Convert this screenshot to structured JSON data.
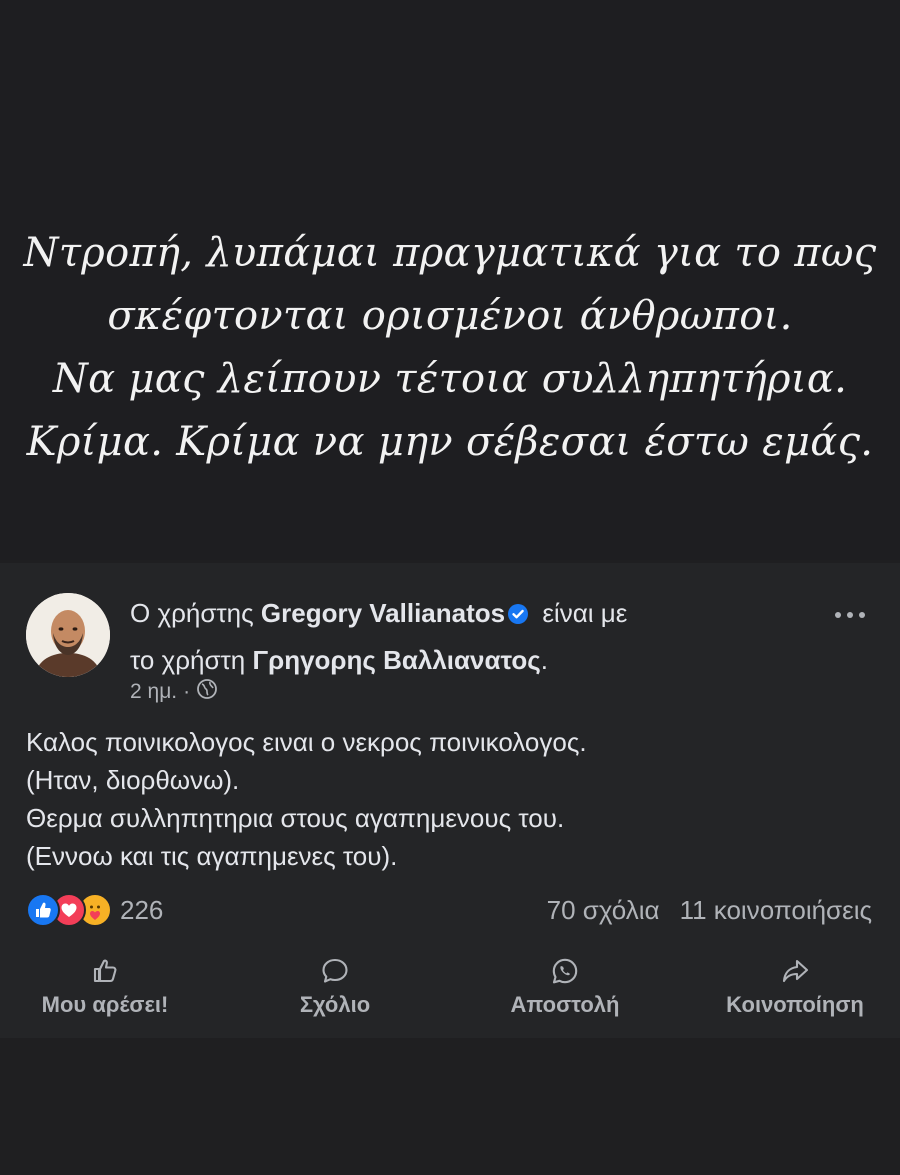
{
  "quote": {
    "lines": [
      "Ντροπή, λυπάμαι πραγματικά για το πως",
      "σκέφτονται ορισμένοι άνθρωποι.",
      "Να μας λείπουν τέτοια συλληπητήρια.",
      "Κρίμα. Κρίμα να μην σέβεσαι έστω εμάς."
    ]
  },
  "post": {
    "header": {
      "prefix": "Ο χρήστης ",
      "author": "Gregory Vallianatos",
      "middle": " είναι με",
      "line2_prefix": "το χρήστη ",
      "tagged": "Γρηγορης Βαλλιανατος",
      "suffix": "."
    },
    "time": "2 ημ.",
    "separator": "·",
    "privacy_icon": "globe-icon",
    "body_lines": [
      "Καλος ποινικολογος ειναι ο νεκρος ποινικολογος.",
      "(Ηταν, διορθωνω).",
      "Θερμα συλληπητηρια στους αγαπημενους του.",
      "(Εννοω και τις αγαπημενες του)."
    ],
    "reactions": {
      "icons": [
        "like-icon",
        "love-icon",
        "care-icon"
      ],
      "count": "226"
    },
    "comments": "70 σχόλια",
    "shares": "11 κοινοποιήσεις",
    "actions": {
      "like": "Μου αρέσει!",
      "comment": "Σχόλιο",
      "send": "Αποστολή",
      "share": "Κοινοποίηση"
    }
  },
  "colors": {
    "background": "#1f1f21",
    "card": "#242527",
    "text": "#e4e6eb",
    "muted": "#b0b3b8",
    "verified": "#1877f2",
    "like": "#1877f2",
    "love": "#f33e58",
    "care": "#f7b125"
  }
}
